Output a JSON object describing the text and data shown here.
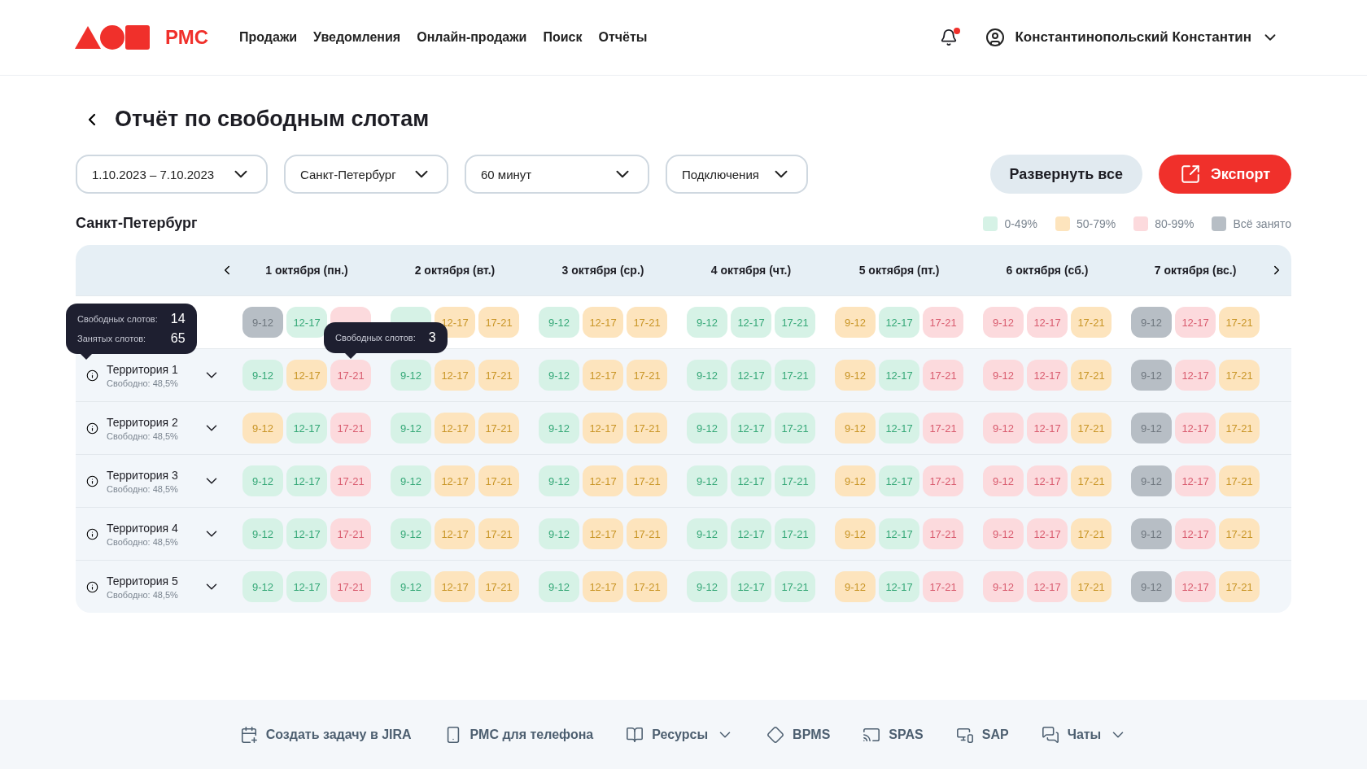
{
  "header": {
    "logo_text": "РМС",
    "nav": [
      "Продажи",
      "Уведомления",
      "Онлайн-продажи",
      "Поиск",
      "Отчёты"
    ],
    "has_notification": true,
    "user_name": "Константинопольский Константин"
  },
  "title": "Отчёт по свободным слотам",
  "filters": [
    "1.10.2023 – 7.10.2023",
    "Санкт-Петербург",
    "60 минут",
    "Подключения"
  ],
  "expand_button": "Развернуть все",
  "export_button": "Экспорт",
  "section_title": "Санкт-Петербург",
  "legend": [
    {
      "label": "0-49%",
      "color": "#d6f2e6"
    },
    {
      "label": "50-79%",
      "color": "#fde4bd"
    },
    {
      "label": "80-99%",
      "color": "#fcdadd"
    },
    {
      "label": "Всё занято",
      "color": "#b7bec5"
    }
  ],
  "table": {
    "days": [
      "1 октября (пн.)",
      "2 октября (вт.)",
      "3 октября (ср.)",
      "4 октября (чт.)",
      "5 октября (пт.)",
      "6 октября (сб.)",
      "7 октября (вс.)"
    ],
    "rows": [
      {
        "hovered": true,
        "days": [
          [
            {
              "label": "9-12",
              "color": "#b7bec5"
            },
            {
              "label": "12-17",
              "color": "#d6f2e6"
            },
            {
              "color": "#fcdadd"
            }
          ],
          [
            {
              "color": "#d6f2e6"
            },
            {
              "label": "12-17",
              "color": "#fde4bd"
            },
            {
              "label": "17-21",
              "color": "#fde4bd"
            }
          ],
          [
            {
              "label": "9-12",
              "color": "#d6f2e6"
            },
            {
              "label": "12-17",
              "color": "#fde4bd"
            },
            {
              "label": "17-21",
              "color": "#fde4bd"
            }
          ],
          [
            {
              "label": "9-12",
              "color": "#d6f2e6"
            },
            {
              "label": "12-17",
              "color": "#d6f2e6"
            },
            {
              "label": "17-21",
              "color": "#d6f2e6"
            }
          ],
          [
            {
              "label": "9-12",
              "color": "#fde4bd"
            },
            {
              "label": "12-17",
              "color": "#d6f2e6"
            },
            {
              "label": "17-21",
              "color": "#fcdadd"
            }
          ],
          [
            {
              "label": "9-12",
              "color": "#fcdadd"
            },
            {
              "label": "12-17",
              "color": "#fcdadd"
            },
            {
              "label": "17-21",
              "color": "#fde4bd"
            }
          ],
          [
            {
              "label": "9-12",
              "color": "#b7bec5"
            },
            {
              "label": "12-17",
              "color": "#fcdadd"
            },
            {
              "label": "17-21",
              "color": "#fde4bd"
            }
          ]
        ]
      },
      {
        "hovered": false,
        "name": "Территория 1",
        "free": "Свободно: 48,5%",
        "tooltip": [
          {
            "label": "Свободных слотов:",
            "value": "14"
          },
          {
            "label": "Занятых слотов:",
            "value": "65"
          }
        ],
        "days": [
          [
            {
              "label": "9-12",
              "color": "#d6f2e6"
            },
            {
              "label": "12-17",
              "color": "#fde4bd"
            },
            {
              "label": "17-21",
              "color": "#fcdadd",
              "tooltip": [
                {
                  "label": "Свободных слотов:",
                  "value": "3"
                }
              ]
            }
          ],
          [
            {
              "label": "9-12",
              "color": "#d6f2e6"
            },
            {
              "label": "12-17",
              "color": "#fde4bd"
            },
            {
              "label": "17-21",
              "color": "#fde4bd"
            }
          ],
          [
            {
              "label": "9-12",
              "color": "#d6f2e6"
            },
            {
              "label": "12-17",
              "color": "#fde4bd"
            },
            {
              "label": "17-21",
              "color": "#fde4bd"
            }
          ],
          [
            {
              "label": "9-12",
              "color": "#d6f2e6"
            },
            {
              "label": "12-17",
              "color": "#d6f2e6"
            },
            {
              "label": "17-21",
              "color": "#d6f2e6"
            }
          ],
          [
            {
              "label": "9-12",
              "color": "#fde4bd"
            },
            {
              "label": "12-17",
              "color": "#d6f2e6"
            },
            {
              "label": "17-21",
              "color": "#fcdadd"
            }
          ],
          [
            {
              "label": "9-12",
              "color": "#fcdadd"
            },
            {
              "label": "12-17",
              "color": "#fcdadd"
            },
            {
              "label": "17-21",
              "color": "#fde4bd"
            }
          ],
          [
            {
              "label": "9-12",
              "color": "#b7bec5"
            },
            {
              "label": "12-17",
              "color": "#fcdadd"
            },
            {
              "label": "17-21",
              "color": "#fde4bd"
            }
          ]
        ]
      },
      {
        "hovered": false,
        "name": "Территория 2",
        "free": "Свободно: 48,5%",
        "days": [
          [
            {
              "label": "9-12",
              "color": "#fde4bd"
            },
            {
              "label": "12-17",
              "color": "#d6f2e6"
            },
            {
              "label": "17-21",
              "color": "#fcdadd"
            }
          ],
          [
            {
              "label": "9-12",
              "color": "#d6f2e6"
            },
            {
              "label": "12-17",
              "color": "#fde4bd"
            },
            {
              "label": "17-21",
              "color": "#fde4bd"
            }
          ],
          [
            {
              "label": "9-12",
              "color": "#d6f2e6"
            },
            {
              "label": "12-17",
              "color": "#fde4bd"
            },
            {
              "label": "17-21",
              "color": "#fde4bd"
            }
          ],
          [
            {
              "label": "9-12",
              "color": "#d6f2e6"
            },
            {
              "label": "12-17",
              "color": "#d6f2e6"
            },
            {
              "label": "17-21",
              "color": "#d6f2e6"
            }
          ],
          [
            {
              "label": "9-12",
              "color": "#fde4bd"
            },
            {
              "label": "12-17",
              "color": "#d6f2e6"
            },
            {
              "label": "17-21",
              "color": "#fcdadd"
            }
          ],
          [
            {
              "label": "9-12",
              "color": "#fcdadd"
            },
            {
              "label": "12-17",
              "color": "#fcdadd"
            },
            {
              "label": "17-21",
              "color": "#fde4bd"
            }
          ],
          [
            {
              "label": "9-12",
              "color": "#b7bec5"
            },
            {
              "label": "12-17",
              "color": "#fcdadd"
            },
            {
              "label": "17-21",
              "color": "#fde4bd"
            }
          ]
        ]
      },
      {
        "hovered": false,
        "name": "Территория 3",
        "free": "Свободно: 48,5%",
        "days": [
          [
            {
              "label": "9-12",
              "color": "#d6f2e6"
            },
            {
              "label": "12-17",
              "color": "#d6f2e6"
            },
            {
              "label": "17-21",
              "color": "#fcdadd"
            }
          ],
          [
            {
              "label": "9-12",
              "color": "#d6f2e6"
            },
            {
              "label": "12-17",
              "color": "#fde4bd"
            },
            {
              "label": "17-21",
              "color": "#fde4bd"
            }
          ],
          [
            {
              "label": "9-12",
              "color": "#d6f2e6"
            },
            {
              "label": "12-17",
              "color": "#fde4bd"
            },
            {
              "label": "17-21",
              "color": "#fde4bd"
            }
          ],
          [
            {
              "label": "9-12",
              "color": "#d6f2e6"
            },
            {
              "label": "12-17",
              "color": "#d6f2e6"
            },
            {
              "label": "17-21",
              "color": "#d6f2e6"
            }
          ],
          [
            {
              "label": "9-12",
              "color": "#fde4bd"
            },
            {
              "label": "12-17",
              "color": "#d6f2e6"
            },
            {
              "label": "17-21",
              "color": "#fcdadd"
            }
          ],
          [
            {
              "label": "9-12",
              "color": "#fcdadd"
            },
            {
              "label": "12-17",
              "color": "#fcdadd"
            },
            {
              "label": "17-21",
              "color": "#fde4bd"
            }
          ],
          [
            {
              "label": "9-12",
              "color": "#b7bec5"
            },
            {
              "label": "12-17",
              "color": "#fcdadd"
            },
            {
              "label": "17-21",
              "color": "#fde4bd"
            }
          ]
        ]
      },
      {
        "hovered": false,
        "name": "Территория 4",
        "free": "Свободно: 48,5%",
        "days": [
          [
            {
              "label": "9-12",
              "color": "#d6f2e6"
            },
            {
              "label": "12-17",
              "color": "#d6f2e6"
            },
            {
              "label": "17-21",
              "color": "#fcdadd"
            }
          ],
          [
            {
              "label": "9-12",
              "color": "#d6f2e6"
            },
            {
              "label": "12-17",
              "color": "#fde4bd"
            },
            {
              "label": "17-21",
              "color": "#fde4bd"
            }
          ],
          [
            {
              "label": "9-12",
              "color": "#d6f2e6"
            },
            {
              "label": "12-17",
              "color": "#fde4bd"
            },
            {
              "label": "17-21",
              "color": "#fde4bd"
            }
          ],
          [
            {
              "label": "9-12",
              "color": "#d6f2e6"
            },
            {
              "label": "12-17",
              "color": "#d6f2e6"
            },
            {
              "label": "17-21",
              "color": "#d6f2e6"
            }
          ],
          [
            {
              "label": "9-12",
              "color": "#fde4bd"
            },
            {
              "label": "12-17",
              "color": "#d6f2e6"
            },
            {
              "label": "17-21",
              "color": "#fcdadd"
            }
          ],
          [
            {
              "label": "9-12",
              "color": "#fcdadd"
            },
            {
              "label": "12-17",
              "color": "#fcdadd"
            },
            {
              "label": "17-21",
              "color": "#fde4bd"
            }
          ],
          [
            {
              "label": "9-12",
              "color": "#b7bec5"
            },
            {
              "label": "12-17",
              "color": "#fcdadd"
            },
            {
              "label": "17-21",
              "color": "#fde4bd"
            }
          ]
        ]
      },
      {
        "hovered": false,
        "name": "Территория 5",
        "free": "Свободно: 48,5%",
        "days": [
          [
            {
              "label": "9-12",
              "color": "#d6f2e6"
            },
            {
              "label": "12-17",
              "color": "#d6f2e6"
            },
            {
              "label": "17-21",
              "color": "#fcdadd"
            }
          ],
          [
            {
              "label": "9-12",
              "color": "#d6f2e6"
            },
            {
              "label": "12-17",
              "color": "#fde4bd"
            },
            {
              "label": "17-21",
              "color": "#fde4bd"
            }
          ],
          [
            {
              "label": "9-12",
              "color": "#d6f2e6"
            },
            {
              "label": "12-17",
              "color": "#fde4bd"
            },
            {
              "label": "17-21",
              "color": "#fde4bd"
            }
          ],
          [
            {
              "label": "9-12",
              "color": "#d6f2e6"
            },
            {
              "label": "12-17",
              "color": "#d6f2e6"
            },
            {
              "label": "17-21",
              "color": "#d6f2e6"
            }
          ],
          [
            {
              "label": "9-12",
              "color": "#fde4bd"
            },
            {
              "label": "12-17",
              "color": "#d6f2e6"
            },
            {
              "label": "17-21",
              "color": "#fcdadd"
            }
          ],
          [
            {
              "label": "9-12",
              "color": "#fcdadd"
            },
            {
              "label": "12-17",
              "color": "#fcdadd"
            },
            {
              "label": "17-21",
              "color": "#fde4bd"
            }
          ],
          [
            {
              "label": "9-12",
              "color": "#b7bec5"
            },
            {
              "label": "12-17",
              "color": "#fcdadd"
            },
            {
              "label": "17-21",
              "color": "#fde4bd"
            }
          ]
        ]
      }
    ]
  },
  "footer": [
    {
      "kind": "jira",
      "label": "Создать задачу в JIRA",
      "expandable": false
    },
    {
      "kind": "phone",
      "label": "РМС для телефона",
      "expandable": false
    },
    {
      "kind": "resources",
      "label": "Ресурсы",
      "expandable": true
    },
    {
      "kind": "bpms",
      "label": "BPMS",
      "expandable": false
    },
    {
      "kind": "spas",
      "label": "SPAS",
      "expandable": false
    },
    {
      "kind": "sap",
      "label": "SAP",
      "expandable": false
    },
    {
      "kind": "chats",
      "label": "Чаты",
      "expandable": true
    }
  ]
}
